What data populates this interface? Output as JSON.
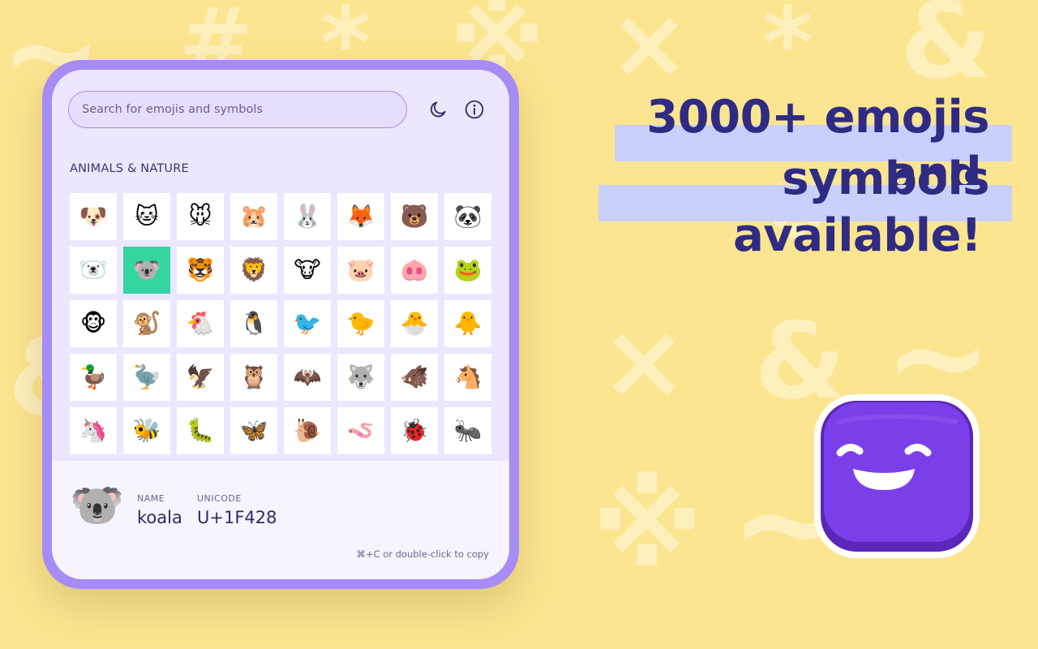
{
  "search": {
    "placeholder": "Search for emojis and symbols"
  },
  "toolbar": {
    "theme_icon": "moon-icon",
    "info_icon": "info-icon"
  },
  "section": {
    "title": "ANIMALS & NATURE"
  },
  "grid": {
    "selected_index": 9,
    "emojis": [
      "🐶",
      "🐱",
      "🐭",
      "🐹",
      "🐰",
      "🦊",
      "🐻",
      "🐼",
      "🐻‍❄️",
      "🐨",
      "🐯",
      "🦁",
      "🐮",
      "🐷",
      "🐽",
      "🐸",
      "🐵",
      "🐒",
      "🐔",
      "🐧",
      "🐦",
      "🐤",
      "🐣",
      "🐥",
      "🦆",
      "🦤",
      "🦅",
      "🦉",
      "🦇",
      "🐺",
      "🐗",
      "🐴",
      "🦄",
      "🐝",
      "🐛",
      "🦋",
      "🐌",
      "🪱",
      "🐞",
      "🐜"
    ]
  },
  "details": {
    "emoji": "🐨",
    "name_label": "NAME",
    "name_value": "koala",
    "unicode_label": "UNICODE",
    "unicode_value": "U+1F428",
    "hint": "⌘+C or double-click to copy"
  },
  "headline": {
    "line1": "3000+ emojis and",
    "line2": "symbols available!"
  },
  "colors": {
    "background": "#fce590",
    "device_border": "#a68cf5",
    "selected_cell": "#33d6a0",
    "headline_text": "#2f2b82",
    "headline_highlight": "#c9d0fb",
    "logo_purple": "#7a3fe8"
  },
  "logo": {
    "icon": "smiling-face-app-icon"
  }
}
